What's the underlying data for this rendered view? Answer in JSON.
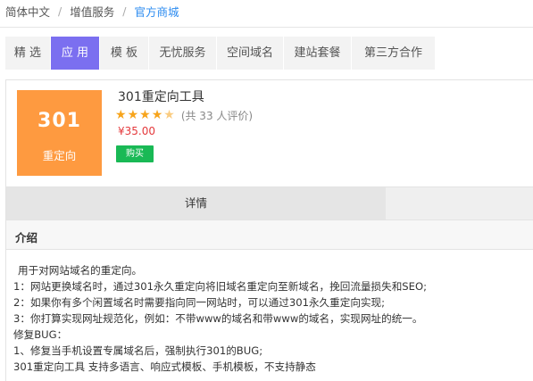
{
  "breadcrumb": {
    "items": [
      "简体中文",
      "增值服务"
    ],
    "current": "官方商城",
    "separator": "/"
  },
  "tabs": [
    {
      "label": "精 选",
      "active": false
    },
    {
      "label": "应 用",
      "active": true
    },
    {
      "label": "模 板",
      "active": false
    },
    {
      "label": "无忧服务",
      "active": false
    },
    {
      "label": "空间域名",
      "active": false
    },
    {
      "label": "建站套餐",
      "active": false
    },
    {
      "label": "第三方合作",
      "active": false
    }
  ],
  "product": {
    "logo_number": "301",
    "logo_text": "重定向",
    "name": "301重定向工具",
    "rating": 4.5,
    "review_text": "(共 33 人评价)",
    "price": "¥35.00",
    "buy_label": "购买"
  },
  "detail": {
    "tab_label": "详情",
    "section_title": "介绍",
    "lines": [
      "用于对网站域名的重定向。",
      "1：网站更换域名时，通过301永久重定向将旧域名重定向至新域名，挽回流量损失和SEO;",
      "2：如果你有多个闲置域名时需要指向同一网站时，可以通过301永久重定向实现;",
      "3：你打算实现网址规范化，例如：不带www的域名和带www的域名，实现网址的统一。",
      "修复BUG：",
      "1、修复当手机设置专属域名后，强制执行301的BUG;",
      "301重定向工具 支持多语言、响应式模板、手机模板，不支持静态"
    ]
  },
  "colors": {
    "accent": "#7b6ff0",
    "link": "#2d8cf0",
    "logo_bg": "#fe9a40",
    "star": "#f7a41b",
    "price": "#e4393c",
    "buy": "#19b955"
  }
}
